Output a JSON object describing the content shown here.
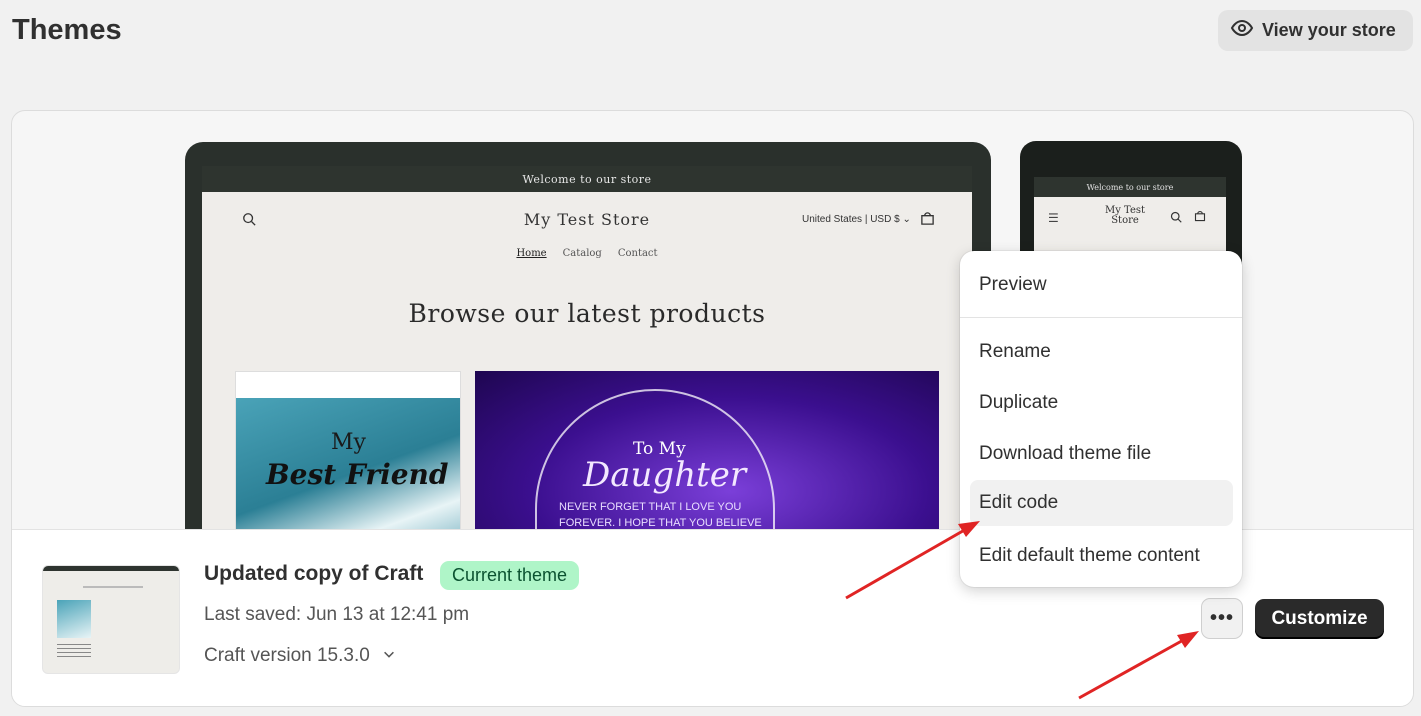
{
  "page": {
    "title": "Themes",
    "view_store_label": "View your store"
  },
  "preview": {
    "announcement": "Welcome to our store",
    "store_name": "My Test Store",
    "locale": "United States | USD $",
    "nav": [
      "Home",
      "Catalog",
      "Contact"
    ],
    "heading": "Browse our latest products",
    "product_a": {
      "line1": "My",
      "line2": "Best Friend"
    },
    "product_b": {
      "line1": "To My",
      "line2": "Daughter",
      "line3": "NEVER FORGET THAT I LOVE YOU",
      "line4": "FOREVER. I HOPE THAT YOU BELIEVE"
    },
    "mobile_announcement": "Welcome to our store",
    "mobile_store_name": "My Test Store"
  },
  "theme": {
    "name": "Updated copy of Craft",
    "badge": "Current theme",
    "last_saved": "Last saved: Jun 13 at 12:41 pm",
    "version": "Craft version 15.3.0",
    "more_label": "•••",
    "customize_label": "Customize"
  },
  "menu": {
    "items": [
      {
        "label": "Preview"
      },
      {
        "label": "Rename"
      },
      {
        "label": "Duplicate"
      },
      {
        "label": "Download theme file"
      },
      {
        "label": "Edit code"
      },
      {
        "label": "Edit default theme content"
      }
    ]
  },
  "colors": {
    "badge_bg": "#aff5c8",
    "primary_button": "#2a2a2a",
    "annotation_arrow": "#e02424"
  }
}
